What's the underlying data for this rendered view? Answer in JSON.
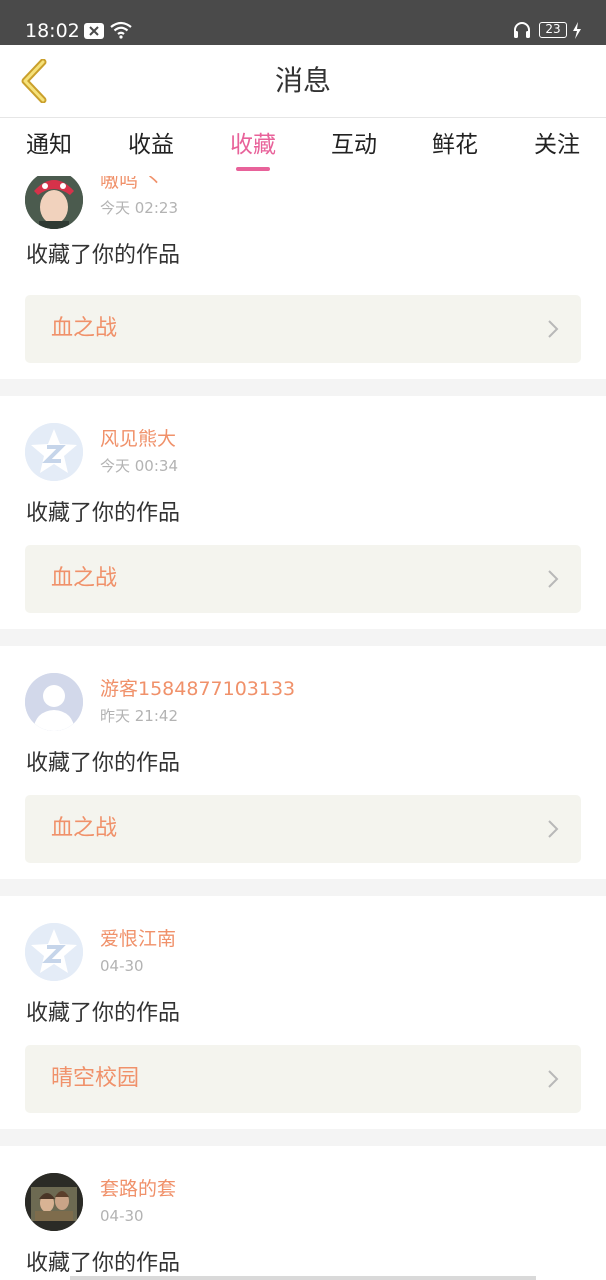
{
  "status_bar": {
    "time": "18:02",
    "battery": "23"
  },
  "header": {
    "title": "消息"
  },
  "tabs": [
    {
      "label": "通知",
      "active": false
    },
    {
      "label": "收益",
      "active": false
    },
    {
      "label": "收藏",
      "active": true
    },
    {
      "label": "互动",
      "active": false
    },
    {
      "label": "鲜花",
      "active": false
    },
    {
      "label": "关注",
      "active": false
    }
  ],
  "colors": {
    "accent": "#e8629a",
    "name_color": "#f0916a"
  },
  "messages": [
    {
      "user": "嗷呜 丶",
      "time": "今天 02:23",
      "action": "收藏了你的作品",
      "work": "血之战",
      "avatar": "photo-avatar"
    },
    {
      "user": "风见熊大",
      "time": "今天 00:34",
      "action": "收藏了你的作品",
      "work": "血之战",
      "avatar": "qq-default-avatar"
    },
    {
      "user": "游客1584877103133",
      "time": "昨天 21:42",
      "action": "收藏了你的作品",
      "work": "血之战",
      "avatar": "guest-default-avatar"
    },
    {
      "user": "爱恨江南",
      "time": "04-30",
      "action": "收藏了你的作品",
      "work": "晴空校园",
      "avatar": "qq-default-avatar"
    },
    {
      "user": "套路的套",
      "time": "04-30",
      "action": "收藏了你的作品",
      "work": "",
      "avatar": "photo-avatar"
    }
  ]
}
